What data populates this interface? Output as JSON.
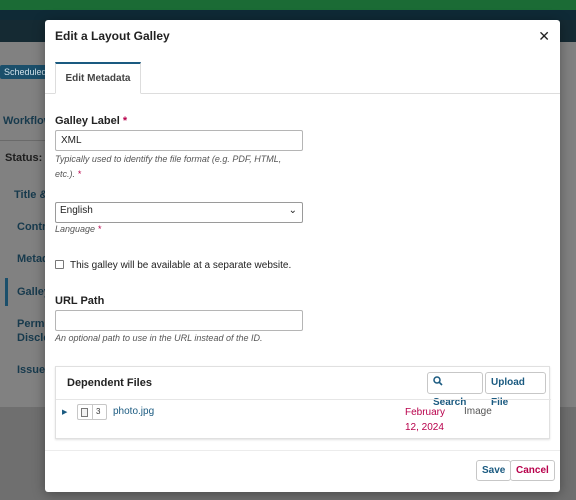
{
  "background": {
    "badge": "Scheduled",
    "workflow": "Workflow",
    "status": "Status: S",
    "nav": [
      "Title &",
      "Contri",
      "Metad",
      "Galley",
      "Permi",
      "Disclo",
      "Issue"
    ]
  },
  "modal": {
    "title": "Edit a Layout Galley",
    "close_icon": "close-icon",
    "tab": "Edit Metadata",
    "galley_label": {
      "label": "Galley Label",
      "required_mark": "*",
      "value": "XML",
      "help_line1": "Typically used to identify the file format (e.g. PDF, HTML,",
      "help_line2": "etc.).",
      "help_required": "*"
    },
    "language": {
      "value": "English",
      "help": "Language",
      "help_required": "*"
    },
    "remote_checkbox": "This galley will be available at a separate website.",
    "url_path": {
      "label": "URL Path",
      "value": "",
      "help": "An optional path to use in the URL instead of the ID."
    },
    "dependent_files": {
      "title": "Dependent Files",
      "search_label": "Search",
      "upload_label": "Upload File",
      "rows": [
        {
          "id": "3",
          "name": "photo.jpg",
          "date_line1": "February",
          "date_line2": "12, 2024",
          "type": "Image"
        }
      ]
    },
    "footer": {
      "save": "Save",
      "cancel": "Cancel"
    }
  },
  "colors": {
    "accent": "#1a5a80",
    "required": "#b8004b",
    "topbar": "#1b6b35"
  }
}
